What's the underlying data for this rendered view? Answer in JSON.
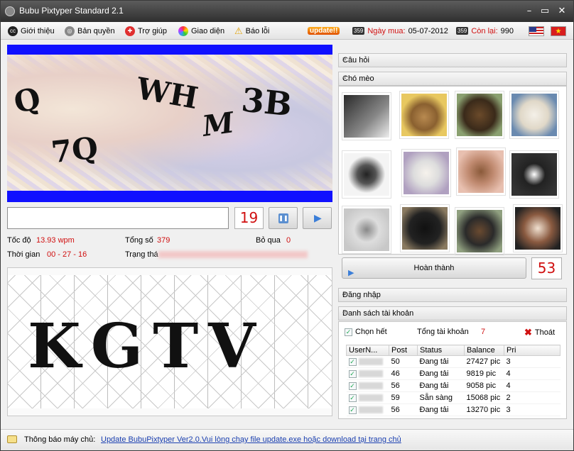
{
  "app": {
    "title": "Bubu Pixtyper Standard 2.1"
  },
  "menu": {
    "about": "Giới thiệu",
    "license": "Bản quyền",
    "help": "Trợ giúp",
    "theme": "Giao diện",
    "report": "Báo lỗi",
    "update_badge": "update!!",
    "code_badge": "359",
    "purchase_label": "Ngày mua:",
    "purchase_date": "05-07-2012",
    "remain_label": "Còn lại:",
    "remain_value": "990"
  },
  "captcha_top": {
    "chars": [
      "Q",
      "WH",
      "M",
      "3B",
      "7Q"
    ]
  },
  "input": {
    "value": "",
    "counter": "19"
  },
  "stats": {
    "speed_label": "Tốc độ",
    "speed_value": "13.93 wpm",
    "total_label": "Tổng số",
    "total_value": "379",
    "skip_label": "Bỏ qua",
    "skip_value": "0",
    "time_label": "Thời gian",
    "time_value": "00 - 27 - 16",
    "state_label": "Trạng thá"
  },
  "captcha_bottom": {
    "text": "KGTV"
  },
  "sections": {
    "question": "Câu hỏi",
    "dogcat": "Chó mèo",
    "login": "Đăng nhập",
    "accounts": "Danh sách tài khoản"
  },
  "pets": {
    "done_label": "Hoàn thành",
    "counter": "53",
    "tiles": [
      "cat",
      "dog",
      "dog",
      "dog",
      "dog",
      "dog",
      "dog",
      "cat",
      "cat",
      "cat",
      "dog",
      "cat"
    ]
  },
  "accounts": {
    "select_all": "Chọn hết",
    "total_label": "Tổng tài khoản",
    "total_value": "7",
    "exit": "Thoát",
    "columns": [
      "UserN...",
      "Post",
      "Status",
      "Balance",
      "Pri"
    ],
    "rows": [
      {
        "post": "50",
        "status": "Đang tải",
        "balance": "27427 pic",
        "pri": "3"
      },
      {
        "post": "46",
        "status": "Đang tải",
        "balance": "9819 pic",
        "pri": "4"
      },
      {
        "post": "56",
        "status": "Đang tải",
        "balance": "9058 pic",
        "pri": "4"
      },
      {
        "post": "59",
        "status": "Sẵn sàng",
        "balance": "15068 pic",
        "pri": "2"
      },
      {
        "post": "56",
        "status": "Đang tải",
        "balance": "13270 pic",
        "pri": "3"
      }
    ]
  },
  "statusbar": {
    "label": "Thông báo máy chủ:",
    "message": "Update BubuPixtyper Ver2.0.Vui lòng chạy file update.exe hoặc download tại trang chủ"
  },
  "colors": {
    "accent_red": "#d01010",
    "captcha_blue": "#1010ff"
  }
}
